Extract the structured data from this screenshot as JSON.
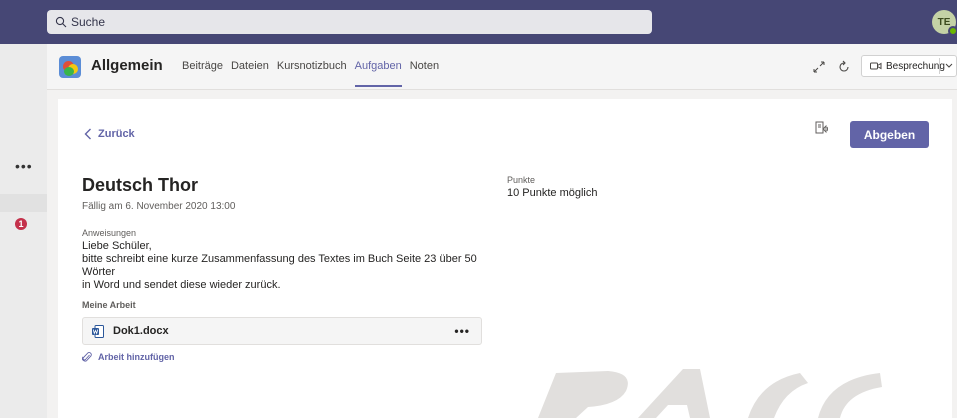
{
  "search": {
    "placeholder": "Suche",
    "icon": "search-icon"
  },
  "user": {
    "initials": "TE",
    "presence_color": "#6bb700"
  },
  "rail": {
    "more_label": "•••",
    "badge_count": "1"
  },
  "header": {
    "team_name": "Allgemein",
    "tabs": [
      {
        "label": "Beiträge"
      },
      {
        "label": "Dateien"
      },
      {
        "label": "Kursnotizbuch"
      },
      {
        "label": "Aufgaben",
        "active": true
      },
      {
        "label": "Noten"
      }
    ],
    "meeting_button": "Besprechung"
  },
  "assignment": {
    "back_label": "Zurück",
    "submit_label": "Abgeben",
    "title": "Deutsch Thor",
    "due": "Fällig am 6. November 2020 13:00",
    "points_label": "Punkte",
    "points_value": "10 Punkte möglich",
    "instructions_label": "Anweisungen",
    "instructions_lines": [
      "Liebe Schüler,",
      "bitte schreibt eine kurze Zusammenfassung des Textes im Buch Seite 23 über 50 Wörter",
      "in Word und sendet diese wieder zurück."
    ],
    "my_work_label": "Meine Arbeit",
    "file_name": "Dok1.docx",
    "file_more": "•••",
    "add_work_label": "Arbeit hinzufügen"
  },
  "colors": {
    "accent": "#6264a7",
    "topbar": "#464775",
    "badge": "#c4314b"
  }
}
